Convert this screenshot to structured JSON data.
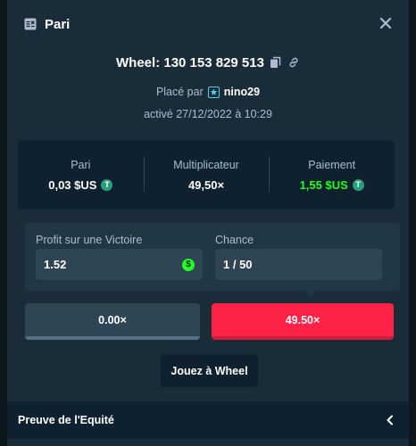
{
  "colors": {
    "modal_bg": "#1a2c38",
    "panel_dark": "#0f212e",
    "panel_mid": "#213743",
    "field_bg": "#2f4553",
    "accent_red": "#fe2247",
    "positive_green": "#1fff20",
    "text_muted": "#b1bad3"
  },
  "header": {
    "title": "Pari",
    "icon": "bet-slip-icon",
    "close_icon": "close-icon"
  },
  "bet": {
    "game_id": "Wheel: 130 153 829 513",
    "copy_icon": "copy-icon",
    "link_icon": "link-icon",
    "placed_by_label": "Placé par",
    "user_icon": "vip-star-icon",
    "username": "nino29",
    "activated": "activé 27/12/2022 à 10:29"
  },
  "stats": {
    "bet_label": "Pari",
    "bet_value": "0,03 $US",
    "multiplier_label": "Multiplicateur",
    "multiplier_value": "49,50×",
    "payout_label": "Paiement",
    "payout_value": "1,55 $US",
    "currency_icon": "tether-coin-icon",
    "currency_symbol": "T"
  },
  "profit": {
    "label": "Profit sur une Victoire",
    "value": "1.52",
    "icon": "dollar-coin-icon",
    "icon_symbol": "$"
  },
  "chance": {
    "label": "Chance",
    "value": "1 / 50"
  },
  "multipliers": {
    "low": "0.00×",
    "high": "49.50×"
  },
  "play_button": "Jouez à Wheel",
  "footer": {
    "label": "Preuve de l'Equité",
    "chevron": "chevron-left-icon"
  }
}
